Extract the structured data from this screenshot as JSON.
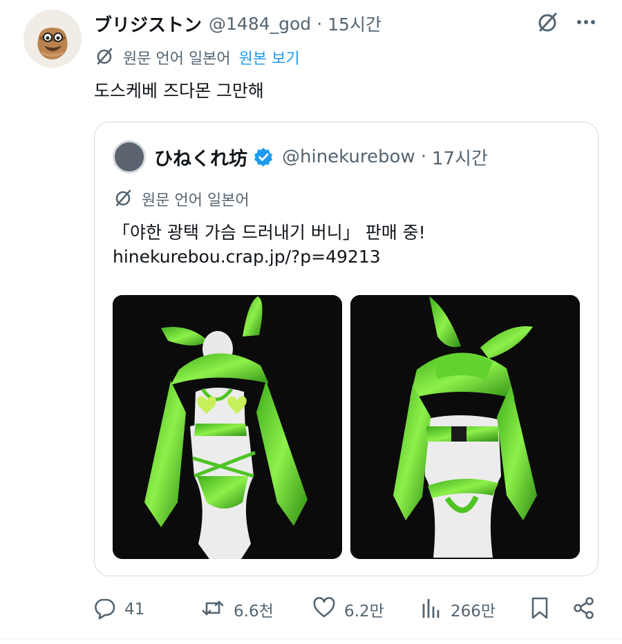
{
  "tweet": {
    "author": {
      "display_name": "ブリジストン",
      "handle": "@1484_god",
      "time": "15시간"
    },
    "translation": {
      "label": "원문 언어 일본어",
      "link": "원본 보기"
    },
    "text": "도스케베 즈다몬 그만해",
    "separator": "·"
  },
  "quote": {
    "author": {
      "display_name": "ひねくれ坊",
      "handle": "@hinekurebow",
      "time": "17시간",
      "verified": true
    },
    "translation": {
      "label": "원문 언어 일본어"
    },
    "text_line1": "「야한 광택 가슴 드러내기 버니」 판매 중!",
    "text_line2": "hinekurebou.crap.jp/?p=49213",
    "separator": "·",
    "media": [
      {
        "description": "green-bunny-costume-front"
      },
      {
        "description": "green-bunny-costume-back"
      }
    ]
  },
  "actions": {
    "replies": "41",
    "retweets": "6.6천",
    "likes": "6.2만",
    "views": "266만"
  },
  "colors": {
    "text": "#0f1419",
    "secondary": "#536471",
    "link": "#1d9bf0",
    "border": "#cfd9de",
    "costume_green": "#5fd12b"
  },
  "icons": [
    "no-translate-icon",
    "more-icon",
    "reply-icon",
    "retweet-icon",
    "like-icon",
    "views-icon",
    "bookmark-icon",
    "share-icon",
    "verified-icon"
  ]
}
